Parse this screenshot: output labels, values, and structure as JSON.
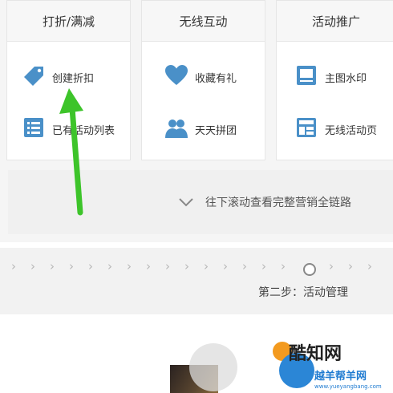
{
  "cards": [
    {
      "title": "打折/满减",
      "items": [
        {
          "label": "创建折扣",
          "icon": "price-tag-icon"
        },
        {
          "label": "已有活动列表",
          "icon": "list-icon"
        }
      ]
    },
    {
      "title": "无线互动",
      "items": [
        {
          "label": "收藏有礼",
          "icon": "heart-icon"
        },
        {
          "label": "天天拼团",
          "icon": "group-icon"
        }
      ]
    },
    {
      "title": "活动推广",
      "items": [
        {
          "label": "主图水印",
          "icon": "picture-icon"
        },
        {
          "label": "无线活动页",
          "icon": "page-layout-icon"
        }
      ]
    }
  ],
  "scroll_hint": {
    "text": "往下滚动查看完整营销全链路",
    "icon": "chevron-down-icon"
  },
  "steps": {
    "label": "第二步：活动管理"
  },
  "watermark": {
    "brand": "酷知网",
    "site": "越羊帮羊网",
    "url": "www.yueyangbang.com"
  },
  "colors": {
    "icon_blue": "#4a90c8",
    "arrow_green": "#3dc42a",
    "card_border": "#e6e6e6"
  }
}
